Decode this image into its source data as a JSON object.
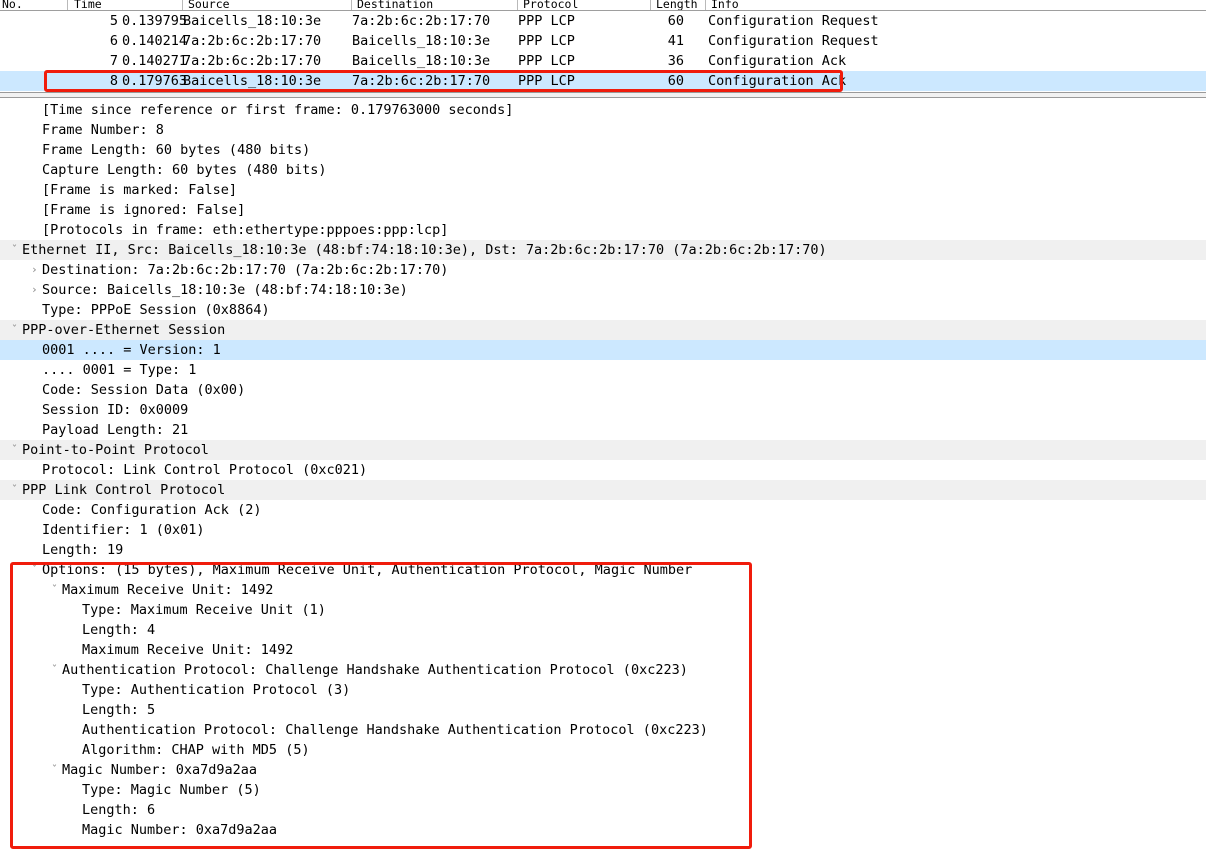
{
  "packet_list": {
    "columns": [
      {
        "key": "no",
        "label": "No."
      },
      {
        "key": "time",
        "label": "Time"
      },
      {
        "key": "source",
        "label": "Source"
      },
      {
        "key": "destination",
        "label": "Destination"
      },
      {
        "key": "protocol",
        "label": "Protocol"
      },
      {
        "key": "length",
        "label": "Length"
      },
      {
        "key": "info",
        "label": "Info"
      }
    ],
    "rows": [
      {
        "no": "5",
        "time": "0.139795",
        "source": "Baicells_18:10:3e",
        "destination": "7a:2b:6c:2b:17:70",
        "protocol": "PPP LCP",
        "length": "60",
        "info": "Configuration Request",
        "selected": false
      },
      {
        "no": "6",
        "time": "0.140214",
        "source": "7a:2b:6c:2b:17:70",
        "destination": "Baicells_18:10:3e",
        "protocol": "PPP LCP",
        "length": "41",
        "info": "Configuration Request",
        "selected": false
      },
      {
        "no": "7",
        "time": "0.140271",
        "source": "7a:2b:6c:2b:17:70",
        "destination": "Baicells_18:10:3e",
        "protocol": "PPP LCP",
        "length": "36",
        "info": "Configuration Ack",
        "selected": false
      },
      {
        "no": "8",
        "time": "0.179763",
        "source": "Baicells_18:10:3e",
        "destination": "7a:2b:6c:2b:17:70",
        "protocol": "PPP LCP",
        "length": "60",
        "info": "Configuration Ack",
        "selected": true
      }
    ]
  },
  "detail_tree": {
    "rows": [
      {
        "indent": 1,
        "twig": "none",
        "style": "normal",
        "text": "[Time since reference or first frame: 0.179763000 seconds]"
      },
      {
        "indent": 1,
        "twig": "none",
        "style": "normal",
        "text": "Frame Number: 8"
      },
      {
        "indent": 1,
        "twig": "none",
        "style": "normal",
        "text": "Frame Length: 60 bytes (480 bits)"
      },
      {
        "indent": 1,
        "twig": "none",
        "style": "normal",
        "text": "Capture Length: 60 bytes (480 bits)"
      },
      {
        "indent": 1,
        "twig": "none",
        "style": "normal",
        "text": "[Frame is marked: False]"
      },
      {
        "indent": 1,
        "twig": "none",
        "style": "normal",
        "text": "[Frame is ignored: False]"
      },
      {
        "indent": 1,
        "twig": "none",
        "style": "normal",
        "text": "[Protocols in frame: eth:ethertype:pppoes:ppp:lcp]"
      },
      {
        "indent": 0,
        "twig": "expanded",
        "style": "proto",
        "text": "Ethernet II, Src: Baicells_18:10:3e (48:bf:74:18:10:3e), Dst: 7a:2b:6c:2b:17:70 (7a:2b:6c:2b:17:70)"
      },
      {
        "indent": 1,
        "twig": "collapsed",
        "style": "normal",
        "text": "Destination: 7a:2b:6c:2b:17:70 (7a:2b:6c:2b:17:70)"
      },
      {
        "indent": 1,
        "twig": "collapsed",
        "style": "normal",
        "text": "Source: Baicells_18:10:3e (48:bf:74:18:10:3e)"
      },
      {
        "indent": 1,
        "twig": "none",
        "style": "normal",
        "text": "Type: PPPoE Session (0x8864)"
      },
      {
        "indent": 0,
        "twig": "expanded",
        "style": "proto",
        "text": "PPP-over-Ethernet Session"
      },
      {
        "indent": 1,
        "twig": "none",
        "style": "sel",
        "text": "0001 .... = Version: 1"
      },
      {
        "indent": 1,
        "twig": "none",
        "style": "normal",
        "text": ".... 0001 = Type: 1"
      },
      {
        "indent": 1,
        "twig": "none",
        "style": "normal",
        "text": "Code: Session Data (0x00)"
      },
      {
        "indent": 1,
        "twig": "none",
        "style": "normal",
        "text": "Session ID: 0x0009"
      },
      {
        "indent": 1,
        "twig": "none",
        "style": "normal",
        "text": "Payload Length: 21"
      },
      {
        "indent": 0,
        "twig": "expanded",
        "style": "proto",
        "text": "Point-to-Point Protocol"
      },
      {
        "indent": 1,
        "twig": "none",
        "style": "normal",
        "text": "Protocol: Link Control Protocol (0xc021)"
      },
      {
        "indent": 0,
        "twig": "expanded",
        "style": "proto",
        "text": "PPP Link Control Protocol"
      },
      {
        "indent": 1,
        "twig": "none",
        "style": "normal",
        "text": "Code: Configuration Ack (2)"
      },
      {
        "indent": 1,
        "twig": "none",
        "style": "normal",
        "text": "Identifier: 1 (0x01)"
      },
      {
        "indent": 1,
        "twig": "none",
        "style": "normal",
        "text": "Length: 19"
      },
      {
        "indent": 1,
        "twig": "expanded",
        "style": "normal",
        "text": "Options: (15 bytes), Maximum Receive Unit, Authentication Protocol, Magic Number"
      },
      {
        "indent": 2,
        "twig": "expanded",
        "style": "normal",
        "text": "Maximum Receive Unit: 1492"
      },
      {
        "indent": 3,
        "twig": "none",
        "style": "normal",
        "text": "Type: Maximum Receive Unit (1)"
      },
      {
        "indent": 3,
        "twig": "none",
        "style": "normal",
        "text": "Length: 4"
      },
      {
        "indent": 3,
        "twig": "none",
        "style": "normal",
        "text": "Maximum Receive Unit: 1492"
      },
      {
        "indent": 2,
        "twig": "expanded",
        "style": "normal",
        "text": "Authentication Protocol: Challenge Handshake Authentication Protocol (0xc223)"
      },
      {
        "indent": 3,
        "twig": "none",
        "style": "normal",
        "text": "Type: Authentication Protocol (3)"
      },
      {
        "indent": 3,
        "twig": "none",
        "style": "normal",
        "text": "Length: 5"
      },
      {
        "indent": 3,
        "twig": "none",
        "style": "normal",
        "text": "Authentication Protocol: Challenge Handshake Authentication Protocol (0xc223)"
      },
      {
        "indent": 3,
        "twig": "none",
        "style": "normal",
        "text": "Algorithm: CHAP with MD5 (5)"
      },
      {
        "indent": 2,
        "twig": "expanded",
        "style": "normal",
        "text": "Magic Number: 0xa7d9a2aa"
      },
      {
        "indent": 3,
        "twig": "none",
        "style": "normal",
        "text": "Type: Magic Number (5)"
      },
      {
        "indent": 3,
        "twig": "none",
        "style": "normal",
        "text": "Length: 6"
      },
      {
        "indent": 3,
        "twig": "none",
        "style": "normal",
        "text": "Magic Number: 0xa7d9a2aa"
      }
    ]
  },
  "annotations": [
    {
      "name": "redbox-packet-row",
      "color": "#f01c0c"
    },
    {
      "name": "redbox-options",
      "color": "#f01c0c"
    }
  ],
  "icons": {
    "expanded": "ˇ",
    "collapsed": "›"
  },
  "colors": {
    "selection_blue": "#cce8ff",
    "protocol_row_gray": "#f0f0f0",
    "annotation_red": "#f01c0c",
    "text": "#000000",
    "twig_gray": "#8a8a8a"
  }
}
